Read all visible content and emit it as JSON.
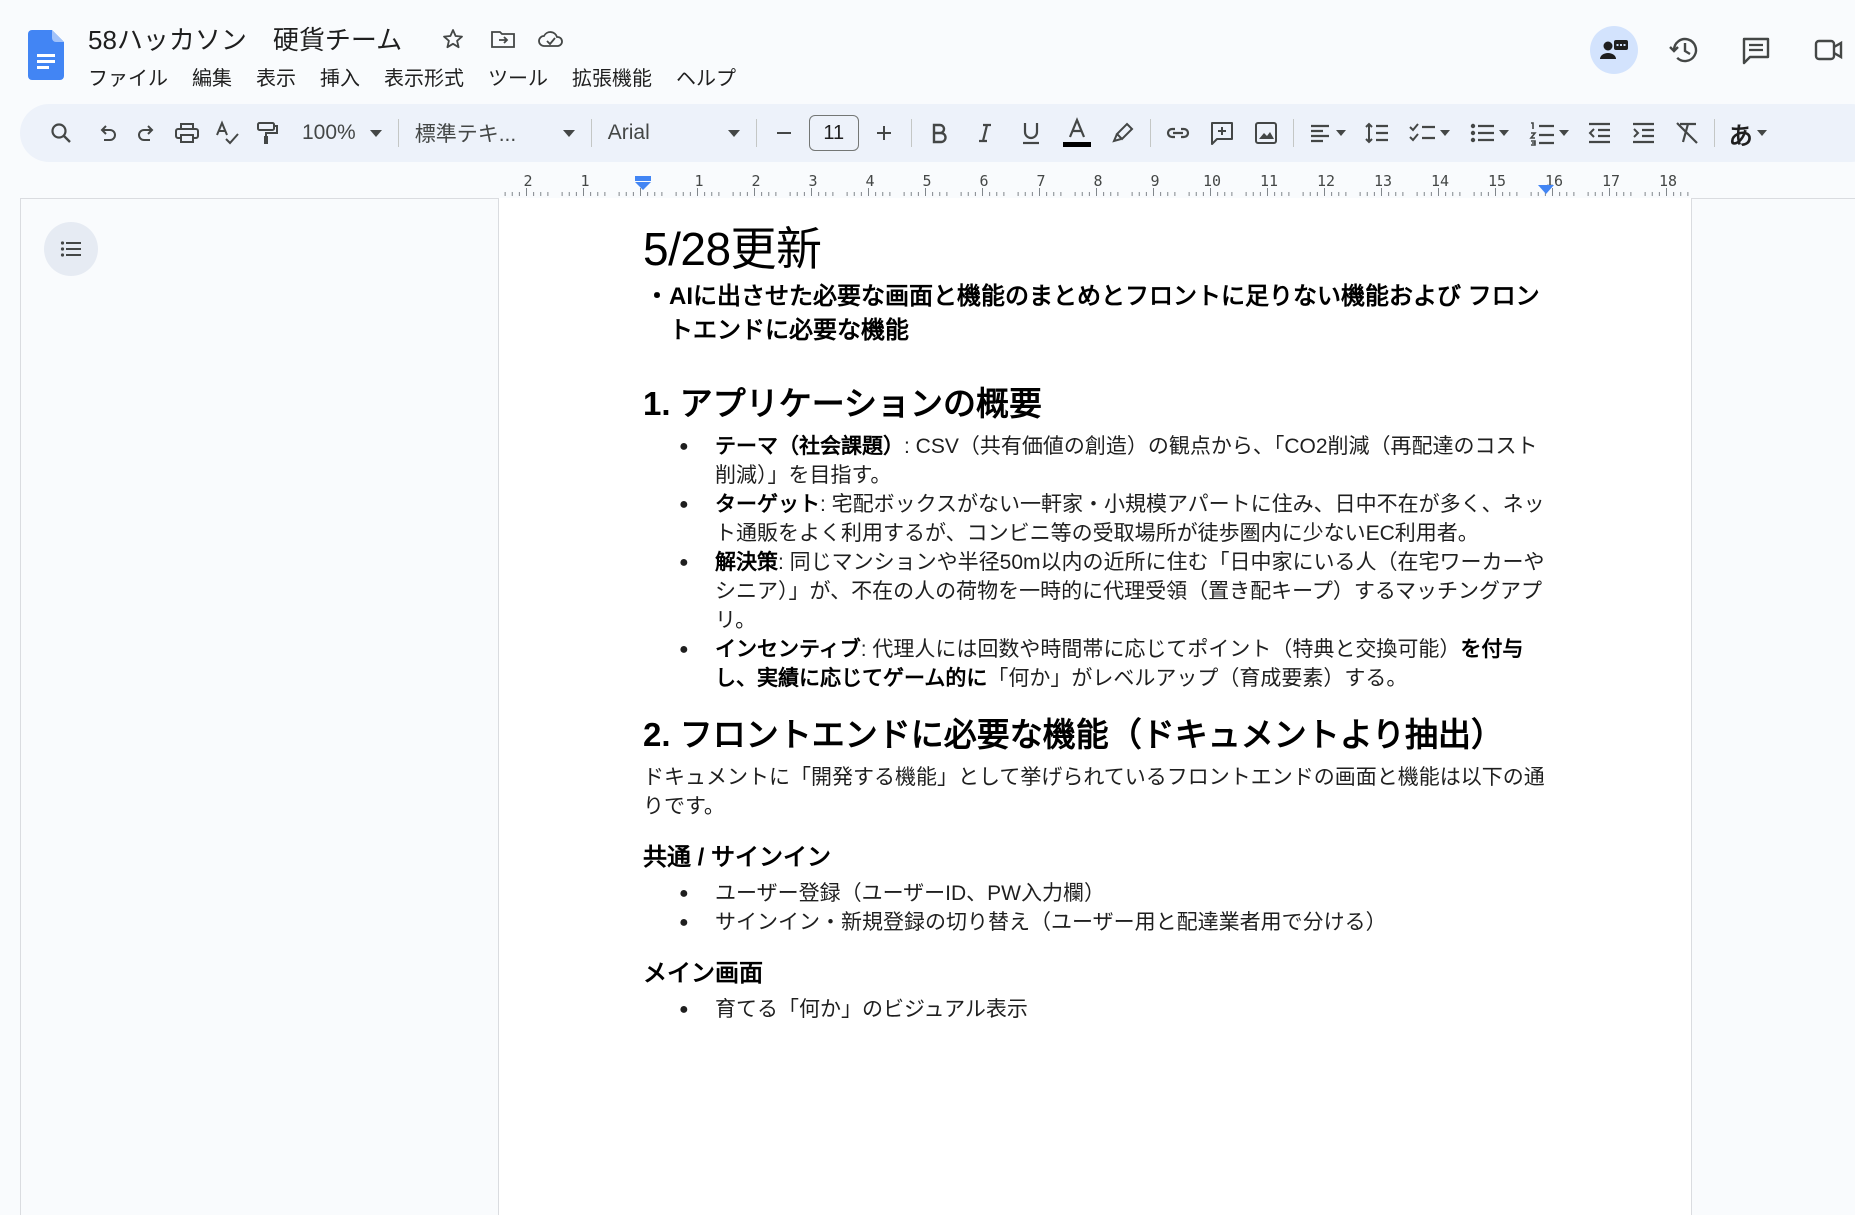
{
  "doc": {
    "title": "58ハッカソン　硬貨チーム"
  },
  "menu": [
    "ファイル",
    "編集",
    "表示",
    "挿入",
    "表示形式",
    "ツール",
    "拡張機能",
    "ヘルプ"
  ],
  "toolbar": {
    "zoom": "100%",
    "style": "標準テキ...",
    "font": "Arial",
    "font_size": "11",
    "input_tool": "あ"
  },
  "ruler": {
    "labels": [
      "2",
      "1",
      "1",
      "2",
      "3",
      "4",
      "5",
      "6",
      "7",
      "8",
      "9",
      "10",
      "11",
      "12",
      "13",
      "14",
      "15",
      "16",
      "17",
      "18"
    ]
  },
  "body": {
    "title": "5/28更新",
    "top_note": "AIに出させた必要な画面と機能のまとめとフロントに足りない機能および フロントエンドに必要な機能",
    "sec1": {
      "heading": "1. アプリケーションの概要",
      "items": [
        {
          "label": "テーマ（社会課題）",
          "text": ": CSV（共有価値の創造）の観点から、「CO2削減（再配達のコスト削減）」を目指す。"
        },
        {
          "label": "ターゲット",
          "text": ": 宅配ボックスがない一軒家・小規模アパートに住み、日中不在が多く、ネット通販をよく利用するが、コンビニ等の受取場所が徒歩圏内に少ないEC利用者。"
        },
        {
          "label": "解決策",
          "text": ": 同じマンションや半径50m以内の近所に住む「日中家にいる人（在宅ワーカーやシニア）」が、不在の人の荷物を一時的に代理受領（置き配キープ）するマッチングアプリ。"
        },
        {
          "label": "インセンティブ",
          "text": ": 代理人には回数や時間帯に応じてポイント（特典と交換可能）",
          "bold_tail": "を付与し、実績に応じてゲーム的に",
          "tail": "「何か」がレベルアップ（育成要素）する。"
        }
      ]
    },
    "sec2": {
      "heading": "2. フロントエンドに必要な機能（ドキュメントより抽出）",
      "intro": "ドキュメントに「開発する機能」として挙げられているフロントエンドの画面と機能は以下の通りです。",
      "sub1": {
        "heading": "共通 / サインイン",
        "items": [
          "ユーザー登録（ユーザーID、PW入力欄）",
          "サインイン・新規登録の切り替え（ユーザー用と配達業者用で分ける）"
        ]
      },
      "sub2": {
        "heading": "メイン画面",
        "items": [
          "育てる「何か」のビジュアル表示"
        ]
      }
    }
  }
}
